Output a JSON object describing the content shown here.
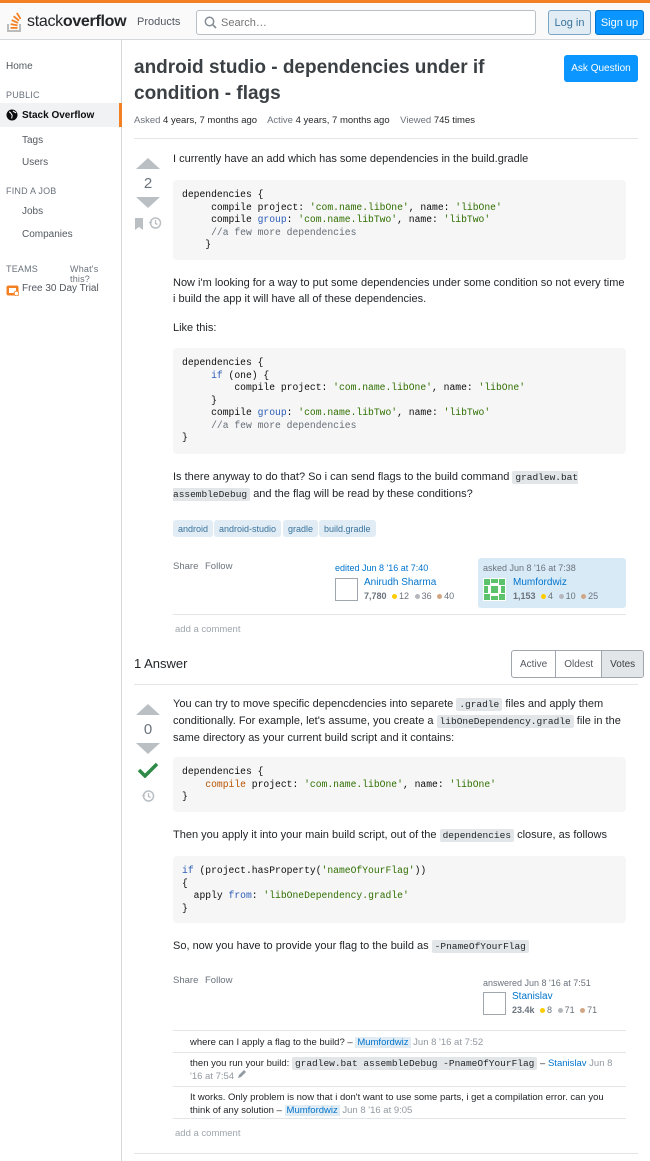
{
  "header": {
    "logo_text_light": "stack",
    "logo_text_bold": "overflow",
    "products_label": "Products",
    "search_placeholder": "Search…",
    "login_label": "Log in",
    "signup_label": "Sign up"
  },
  "sidebar": {
    "home": "Home",
    "public_heading": "PUBLIC",
    "stack_overflow": "Stack Overflow",
    "tags": "Tags",
    "users": "Users",
    "find_job_heading": "FIND A JOB",
    "jobs": "Jobs",
    "companies": "Companies",
    "teams_heading": "TEAMS",
    "whats_this": "What's this?",
    "free_trial": "Free 30 Day Trial"
  },
  "question": {
    "title": "android studio - dependencies under if condition - flags",
    "ask_button": "Ask Question",
    "asked_label": "Asked",
    "asked_value": "4 years, 7 months ago",
    "active_label": "Active",
    "active_value": "4 years, 7 months ago",
    "viewed_label": "Viewed",
    "viewed_value": "745 times",
    "votes": "2",
    "p1": "I currently have an add which has some dependencies in the build.gradle",
    "p2": "Now i'm looking for a way to put some dependencies under some condition so not every time i build the app it will have all of these dependencies.",
    "p3": "Like this:",
    "p4_a": "Is there anyway to do that? So i can send flags to the build command",
    "p4_code": "gradlew.bat assembleDebug",
    "p4_b": "and the flag will be read by these conditions?",
    "tags": [
      "android",
      "android-studio",
      "gradle",
      "build.gradle"
    ],
    "share": "Share",
    "follow": "Follow",
    "edited_label": "edited Jun 8 '16 at 7:40",
    "editor_name": "Anirudh Sharma",
    "editor_rep": "7,780",
    "editor_gold": "12",
    "editor_silver": "36",
    "editor_bronze": "40",
    "asked_card_label": "asked Jun 8 '16 at 7:38",
    "asker_name": "Mumfordwiz",
    "asker_rep": "1,153",
    "asker_gold": "4",
    "asker_silver": "10",
    "asker_bronze": "25",
    "add_comment": "add a comment"
  },
  "answers": {
    "count_label": "1 Answer",
    "sort_options": [
      "Active",
      "Oldest",
      "Votes"
    ],
    "votes": "0",
    "p1_a": "You can try to move specific depencdencies into separete",
    "p1_code1": ".gradle",
    "p1_b": "files and apply them conditionally. For example, let's assume, you create a",
    "p1_code2": "libOneDependency.gradle",
    "p1_c": "file in the same directory as your current build script and it contains:",
    "p2_a": "Then you apply it into your main build script, out of the",
    "p2_code": "dependencies",
    "p2_b": "closure, as follows",
    "p3_a": "So, now you have to provide your flag to the build as",
    "p3_code": "-PnameOfYourFlag",
    "share": "Share",
    "follow": "Follow",
    "answered_label": "answered Jun 8 '16 at 7:51",
    "answerer_name": "Stanislav",
    "answerer_rep": "23.4k",
    "answerer_gold": "8",
    "answerer_silver": "71",
    "answerer_bronze": "71",
    "comments": [
      {
        "text": "where can I apply a flag to the build? –",
        "user": "Mumfordwiz",
        "date": "Jun 8 '16 at 7:52"
      },
      {
        "text_a": "then you run your build:",
        "code": "gradlew.bat assembleDebug -PnameOfYourFlag",
        "dash": "–",
        "user": "Stanislav",
        "date": "Jun 8 '16 at 7:54"
      },
      {
        "text": "It works. Only problem is now that i don't want to use some parts, i get a compilation error. can you think of any solution –",
        "user": "Mumfordwiz",
        "date": "Jun 8 '16 at 9:05"
      }
    ],
    "add_comment": "add a comment"
  }
}
